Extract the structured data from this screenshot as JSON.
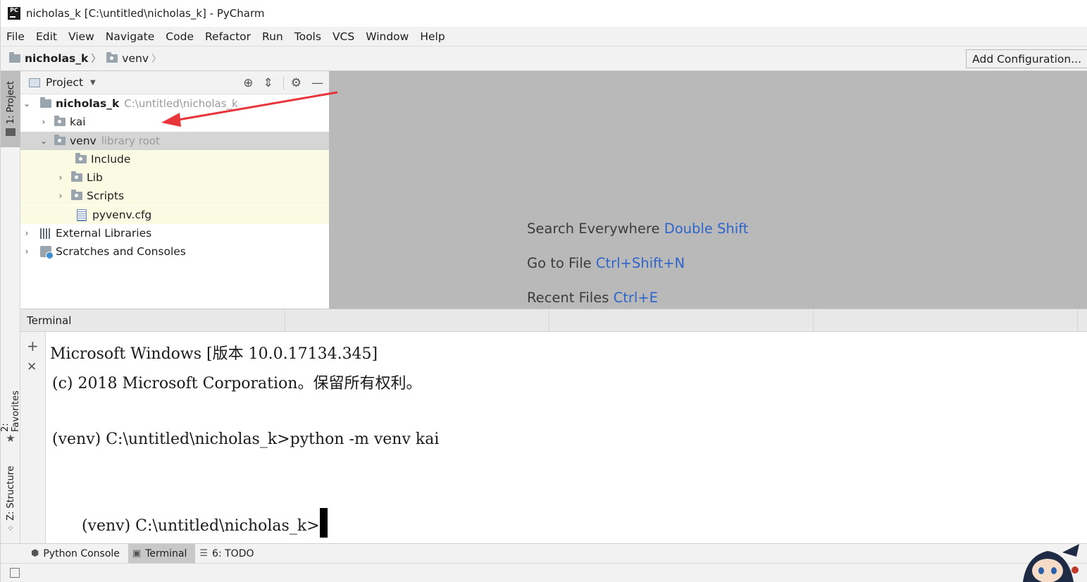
{
  "window": {
    "title": "nicholas_k [C:\\untitled\\nicholas_k] - PyCharm",
    "logo_text": "PC"
  },
  "menu": [
    "File",
    "Edit",
    "View",
    "Navigate",
    "Code",
    "Refactor",
    "Run",
    "Tools",
    "VCS",
    "Window",
    "Help"
  ],
  "breadcrumb": {
    "project": "nicholas_k",
    "folder": "venv"
  },
  "toolbar": {
    "add_configuration": "Add Configuration..."
  },
  "left_tabs": {
    "project": "1: Project",
    "favorites": "2: Favorites",
    "structure": "Z: Structure"
  },
  "project_panel": {
    "header": "Project",
    "tree": {
      "root_name": "nicholas_k",
      "root_path": "C:\\untitled\\nicholas_k",
      "kai": "kai",
      "venv": "venv",
      "venv_hint": "library root",
      "include": "Include",
      "lib": "Lib",
      "scripts": "Scripts",
      "pyvenv": "pyvenv.cfg",
      "external_libraries": "External Libraries",
      "scratches": "Scratches and Consoles"
    }
  },
  "editor_tips": {
    "search_label": "Search Everywhere",
    "search_key": "Double Shift",
    "goto_label": "Go to File",
    "goto_key": "Ctrl+Shift+N",
    "recent_label": "Recent Files",
    "recent_key": "Ctrl+E"
  },
  "terminal": {
    "header": "Terminal",
    "lines": [
      "Microsoft Windows [版本 10.0.17134.345]",
      "(c) 2018 Microsoft Corporation。保留所有权利。",
      "(venv) C:\\untitled\\nicholas_k>python -m venv kai",
      "(venv) C:\\untitled\\nicholas_k>"
    ]
  },
  "bottom_tabs": {
    "python_console": "Python Console",
    "terminal": "Terminal",
    "todo": "6: TODO"
  },
  "colors": {
    "accent_key": "#2f65ca",
    "annotation_arrow": "#e8343b",
    "editor_bg": "#b9b9b9",
    "venv_highlight": "#fbfbe3"
  }
}
